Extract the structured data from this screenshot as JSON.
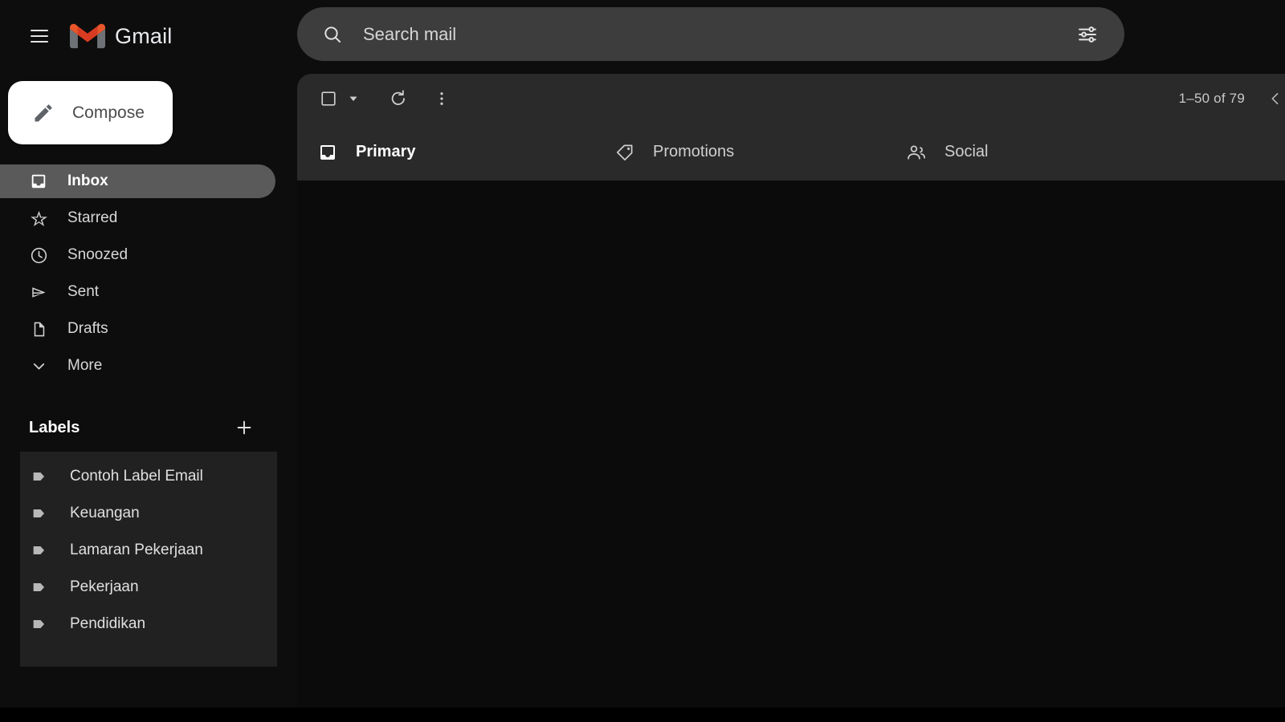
{
  "app": {
    "title": "Gmail",
    "theme": "dark"
  },
  "header": {
    "menu_icon": "hamburger-menu-icon",
    "logo_icon": "gmail-logo-icon",
    "brand": "Gmail"
  },
  "search": {
    "placeholder": "Search mail",
    "value": "",
    "search_icon": "search-icon",
    "filter_icon": "tune-filter-icon"
  },
  "compose": {
    "label": "Compose",
    "icon": "pencil-edit-icon"
  },
  "sidebar": {
    "items": [
      {
        "label": "Inbox",
        "icon": "inbox-icon",
        "active": true
      },
      {
        "label": "Starred",
        "icon": "star-outline-icon",
        "active": false
      },
      {
        "label": "Snoozed",
        "icon": "clock-icon",
        "active": false
      },
      {
        "label": "Sent",
        "icon": "send-icon",
        "active": false
      },
      {
        "label": "Drafts",
        "icon": "document-icon",
        "active": false
      },
      {
        "label": "More",
        "icon": "chevron-down-icon",
        "active": false
      }
    ],
    "labels_section": {
      "title": "Labels",
      "add_icon": "plus-icon",
      "items": [
        {
          "label": "Contoh Label Email",
          "icon": "label-tag-icon"
        },
        {
          "label": "Keuangan",
          "icon": "label-tag-icon"
        },
        {
          "label": "Lamaran Pekerjaan",
          "icon": "label-tag-icon"
        },
        {
          "label": "Pekerjaan",
          "icon": "label-tag-icon"
        },
        {
          "label": "Pendidikan",
          "icon": "label-tag-icon"
        }
      ]
    }
  },
  "toolbar": {
    "select_all_icon": "checkbox-unchecked-icon",
    "select_all_caret_icon": "caret-down-icon",
    "refresh_icon": "refresh-icon",
    "more_options_icon": "more-vertical-icon",
    "page_range": "1–50 of 79",
    "prev_page_icon": "chevron-left-icon"
  },
  "tabs": [
    {
      "label": "Primary",
      "icon": "inbox-tab-icon",
      "active": true
    },
    {
      "label": "Promotions",
      "icon": "tag-icon",
      "active": false
    },
    {
      "label": "Social",
      "icon": "people-icon",
      "active": false
    }
  ],
  "message_list": {
    "messages": [],
    "empty": true
  },
  "colors": {
    "page_background": "#0d0d0d",
    "panel_background": "#2a2a2a",
    "search_background": "#3d3d3d",
    "list_background": "#0b0b0b",
    "labels_panel_background": "#212121",
    "active_nav_background": "#5a5a5a",
    "compose_background": "#ffffff",
    "logo_red": "#d93025",
    "text_primary": "#e8eaed",
    "text_secondary": "#c9c9c9"
  }
}
